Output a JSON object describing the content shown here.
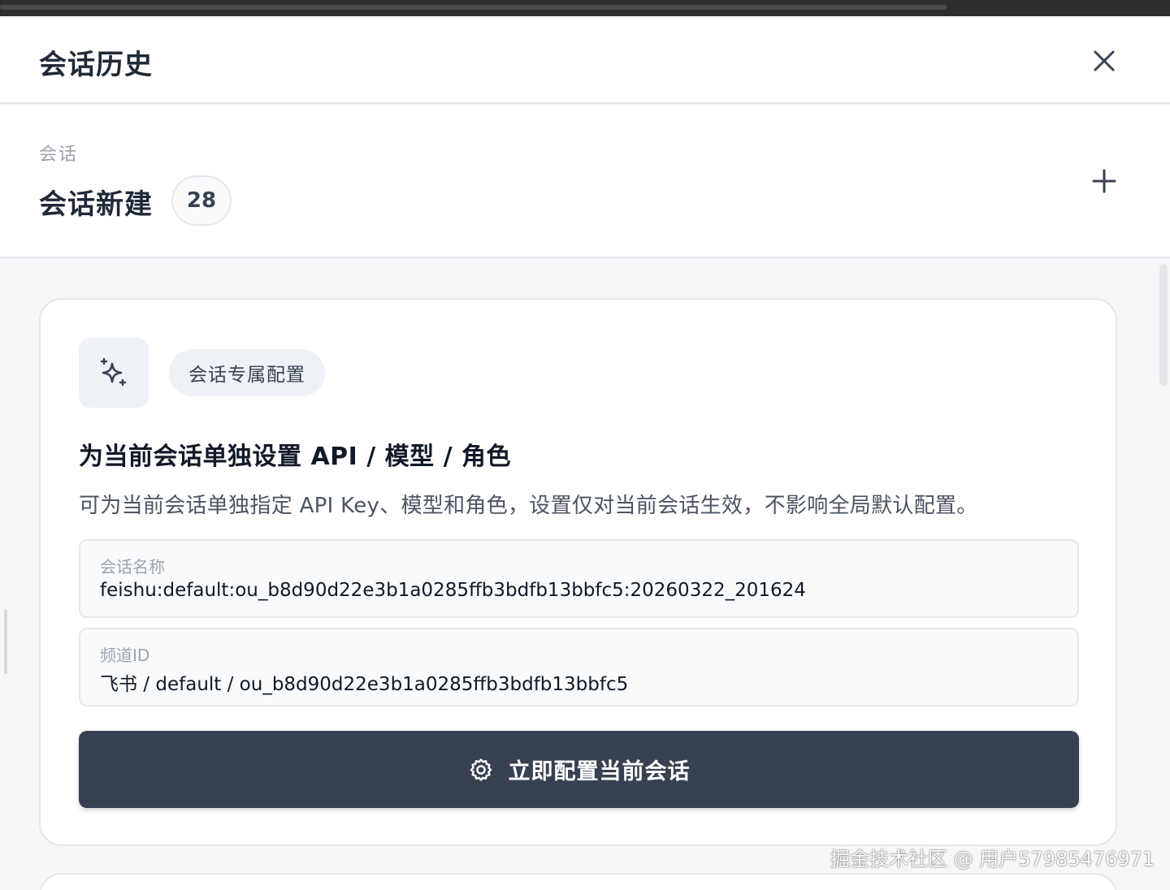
{
  "header": {
    "title": "会话历史",
    "close_icon": "close-icon"
  },
  "session": {
    "label": "会话",
    "title": "会话新建",
    "count": "28",
    "add_icon": "plus-icon"
  },
  "card": {
    "icon": "sparkles-icon",
    "chip_label": "会话专属配置",
    "heading": "为当前会话单独设置 API / 模型 / 角色",
    "description": "可为当前会话单独指定 API Key、模型和角色，设置仅对当前会话生效，不影响全局默认配置。",
    "fields": [
      {
        "label": "会话名称",
        "value": "feishu:default:ou_b8d90d22e3b1a0285ffb3bdfb13bbfc5:20260322_201624"
      },
      {
        "label": "频道ID",
        "value": "飞书 / default / ou_b8d90d22e3b1a0285ffb3bdfb13bbfc5"
      }
    ],
    "button": {
      "icon": "gear-icon",
      "label": "立即配置当前会话"
    }
  },
  "watermark": "掘金技术社区 @ 用户57985476971",
  "colors": {
    "primary_button": "#374151",
    "panel_bg": "#f6f7f9",
    "card_bg": "#ffffff",
    "chip_bg": "#eef1f5",
    "title_text": "#1f2937",
    "muted_text": "#9ca3af"
  }
}
